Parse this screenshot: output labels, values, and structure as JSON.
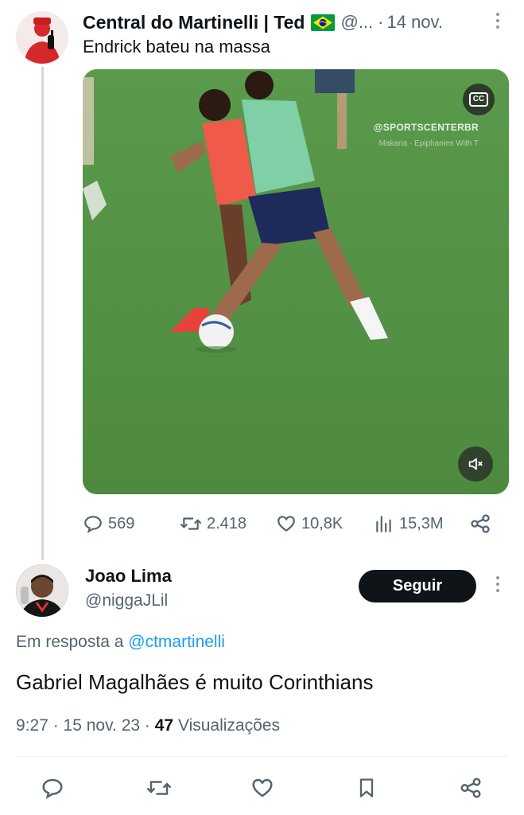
{
  "parent_tweet": {
    "author_name": "Central do Martinelli | Ted",
    "handle_truncated": "@...",
    "separator": "·",
    "date": "14 nov.",
    "text": "Endrick bateu na massa",
    "video": {
      "watermark": "@SPORTSCENTERBR",
      "watermark_sub": "Makana · Epiphanies With T",
      "cc_label": "CC"
    },
    "stats": {
      "replies": "569",
      "reposts": "2.418",
      "likes": "10,8K",
      "views": "15,3M"
    }
  },
  "reply_tweet": {
    "author_name": "Joao Lima",
    "handle": "@niggaJLil",
    "follow_label": "Seguir",
    "reply_prefix": "Em resposta a",
    "reply_mention": "@ctmartinelli",
    "text": "Gabriel Magalhães é muito Corinthians",
    "time": "9:27",
    "date": "15 nov. 23",
    "views_count": "47",
    "views_label": "Visualizações"
  },
  "colors": {
    "text_primary": "#0f1419",
    "text_secondary": "#536471",
    "link": "#1d9bf0",
    "follow_bg": "#0f1419"
  },
  "icons": [
    "reply-icon",
    "repost-icon",
    "like-icon",
    "views-icon",
    "share-icon",
    "bookmark-icon",
    "more-icon",
    "mute-icon",
    "cc-icon"
  ]
}
